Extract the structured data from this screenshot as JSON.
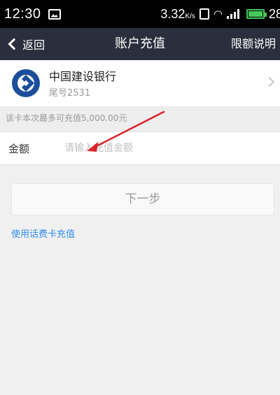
{
  "status_bar": {
    "time": "12:30",
    "data_speed": "3.32",
    "data_unit": "K/s",
    "battery_level": "28",
    "battery_color": "#46c85a"
  },
  "nav": {
    "back_label": "返回",
    "title": "账户充值",
    "right_label": "限额说明"
  },
  "card": {
    "bank_name": "中国建设银行",
    "tail_number": "尾号2531",
    "logo_color": "#1b4e9b"
  },
  "limit_hint": "该卡本次最多可充值5,000.00元",
  "amount": {
    "label": "金额",
    "placeholder": "请输入充值金额",
    "value": ""
  },
  "next_button_label": "下一步",
  "phone_card_link": "使用话费卡充值",
  "colors": {
    "nav_bg": "#2b2f3d",
    "link": "#2d8cf0",
    "annotation_arrow": "#d9242b"
  }
}
